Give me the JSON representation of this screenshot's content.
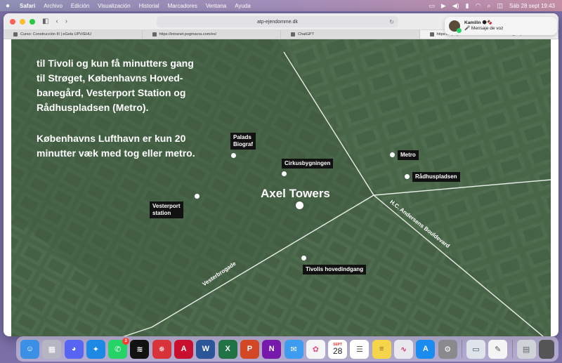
{
  "menubar": {
    "apple_icon": "apple-icon",
    "items": [
      "Safari",
      "Archivo",
      "Edición",
      "Visualización",
      "Historial",
      "Marcadores",
      "Ventana",
      "Ayuda"
    ],
    "datetime": "Sáb 28 sept 19:43"
  },
  "browser": {
    "url": "atp-ejendomme.dk",
    "tabs": [
      {
        "label": "Curso: Construcción III | eGela UPV/EHU"
      },
      {
        "label": "https://intranet.pogmacra.com/es/"
      },
      {
        "label": "ChatGPT"
      },
      {
        "label": "https://atp-ejendomme.dk/media/axel-towers_b0.pdf"
      }
    ]
  },
  "map": {
    "intro_text": "til Tivoli og kun få minutters gang\ntil Strøget, Københavns Hoved-\nbanegård, Vesterport Station og\nRådhuspladsen (Metro).",
    "airport_text": "Københavns Lufthavn er kun 20\nminutter væk med tog eller metro.",
    "title": "Axel Towers",
    "pois": {
      "palads": "Palads\nBiograf",
      "cirkus": "Cirkusbygningen",
      "metro": "Metro",
      "radhus": "Rådhuspladsen",
      "vesterport": "Vesterport\nstation",
      "tivoli": "Tivolis hovedindgang"
    },
    "streets": {
      "hc": "H.C. Andersens Bouldevard",
      "vesterbrogade": "Vesterbrogade"
    }
  },
  "notification": {
    "sender": "Kamilin 🌑🍫",
    "message": "🎤 Mensaje de voz"
  },
  "dock": {
    "calendar_month": "SEPT",
    "calendar_day": "28",
    "whatsapp_badge": "3",
    "apps": [
      {
        "name": "finder-icon",
        "color": "#3b8fe5",
        "glyph": "☺"
      },
      {
        "name": "launchpad-icon",
        "color": "#b6b6c2",
        "glyph": "▦"
      },
      {
        "name": "discord-icon",
        "color": "#5865f2",
        "glyph": "◕"
      },
      {
        "name": "safari-icon",
        "color": "#1e88e5",
        "glyph": "✦"
      },
      {
        "name": "whatsapp-icon",
        "color": "#25d366",
        "glyph": "✆"
      },
      {
        "name": "spotify-icon",
        "color": "#111111",
        "glyph": "≋"
      },
      {
        "name": "settings-gear-icon",
        "color": "#d8333b",
        "glyph": "✵"
      },
      {
        "name": "autocad-icon",
        "color": "#c8102e",
        "glyph": "A"
      },
      {
        "name": "word-icon",
        "color": "#2b579a",
        "glyph": "W"
      },
      {
        "name": "excel-icon",
        "color": "#217346",
        "glyph": "X"
      },
      {
        "name": "powerpoint-icon",
        "color": "#d24726",
        "glyph": "P"
      },
      {
        "name": "onenote-icon",
        "color": "#7719aa",
        "glyph": "N"
      },
      {
        "name": "mail-icon",
        "color": "#3d9cf0",
        "glyph": "✉"
      },
      {
        "name": "photos-icon",
        "color": "#f5f5f5",
        "glyph": "✿"
      },
      {
        "name": "calendar-icon",
        "color": "#ffffff",
        "glyph": ""
      },
      {
        "name": "reminders-icon",
        "color": "#ffffff",
        "glyph": "☰"
      },
      {
        "name": "notes-icon",
        "color": "#f7d54a",
        "glyph": "≡"
      },
      {
        "name": "activity-icon",
        "color": "#e8e8ee",
        "glyph": "∿"
      },
      {
        "name": "app-store-icon",
        "color": "#1a8cf0",
        "glyph": "A"
      },
      {
        "name": "system-settings-icon",
        "color": "#8a8a8e",
        "glyph": "⚙"
      },
      {
        "name": "preview-icon",
        "color": "#dfe3ea",
        "glyph": "▭"
      },
      {
        "name": "textedit-icon",
        "color": "#f4f4f4",
        "glyph": "✎"
      },
      {
        "name": "trash-icon",
        "color": "#cfd3d8",
        "glyph": "🗑"
      },
      {
        "name": "desktop-thumbnail-icon",
        "color": "#555",
        "glyph": ""
      }
    ]
  }
}
